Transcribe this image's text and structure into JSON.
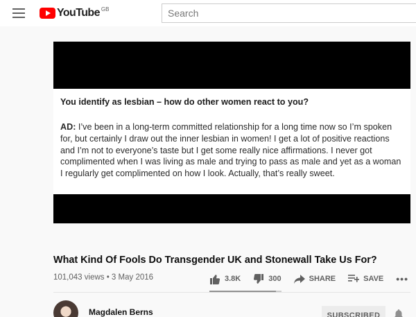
{
  "masthead": {
    "logo_text": "YouTube",
    "region": "GB",
    "search_placeholder": "Search"
  },
  "player": {
    "frame_question": "You identify as lesbian – how do other women react to you?",
    "frame_answer_speaker": "AD:",
    "frame_answer_text": " I’ve been in a long-term committed relationship for a long time now so I’m spoken for, but certainly I draw out the inner lesbian in women! I get a lot of positive reactions and I’m not to everyone’s taste but I get some really nice affirmations. I never got complimented when I was living as male and trying to pass as male and yet as a woman I regularly get complimented on how I look. Actually, that’s really sweet."
  },
  "video": {
    "title": "What Kind Of Fools Do Transgender UK and Stonewall Take Us For?",
    "meta": "101,043 views • 3 May 2016",
    "likes": "3.8K",
    "dislikes": "300",
    "share_label": "SHARE",
    "save_label": "SAVE",
    "more_label": "•••",
    "like_ratio": 0.927
  },
  "channel": {
    "name": "Magdalen Berns",
    "subscribe_label": "SUBSCRIBED"
  },
  "colors": {
    "brand_red": "#ff0000",
    "background": "#f9f9f9",
    "icon_grey": "#606060"
  },
  "icons": [
    "menu-icon",
    "youtube-logo-icon",
    "thumbs-up-icon",
    "thumbs-down-icon",
    "share-icon",
    "save-playlist-icon",
    "more-icon",
    "bell-icon"
  ]
}
